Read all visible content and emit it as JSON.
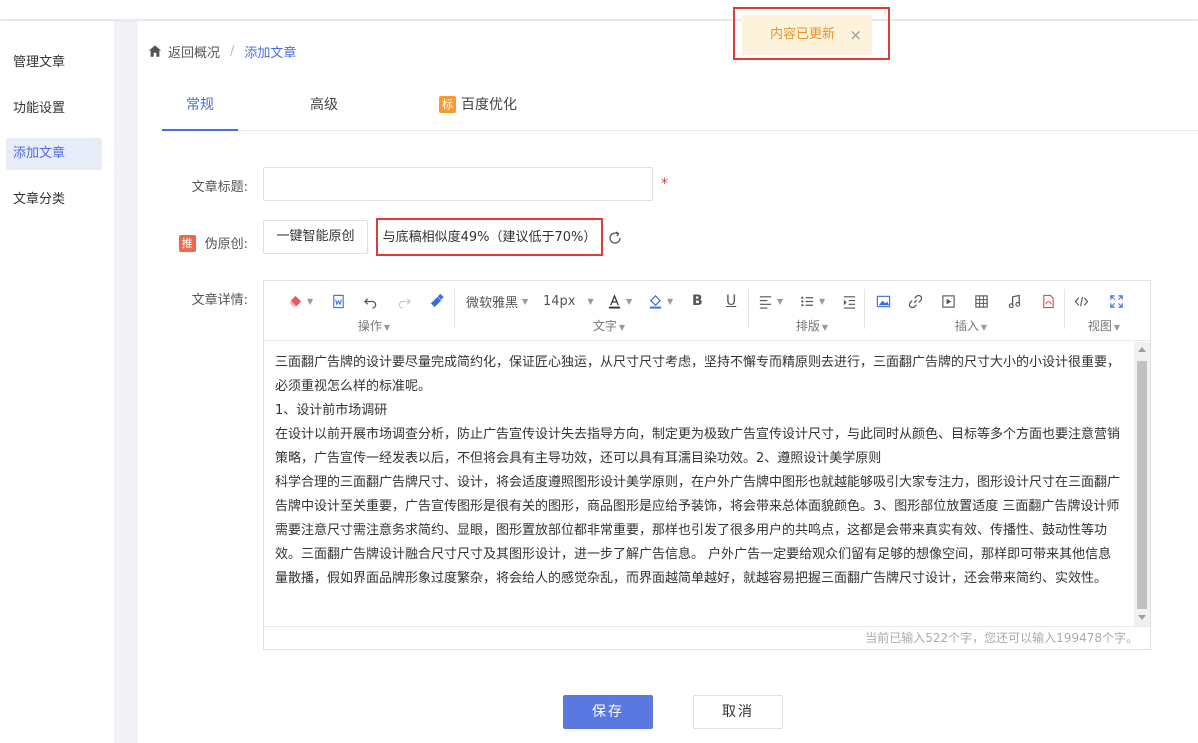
{
  "sidebar": {
    "items": [
      {
        "label": "管理文章"
      },
      {
        "label": "功能设置"
      },
      {
        "label": "添加文章"
      },
      {
        "label": "文章分类"
      }
    ]
  },
  "breadcrumb": {
    "back": "返回概况",
    "separator": "/",
    "current": "添加文章"
  },
  "tabs": [
    {
      "label": "常规"
    },
    {
      "label": "高级"
    },
    {
      "label": "百度优化",
      "badge": "标"
    }
  ],
  "form": {
    "title_label": "文章标题:",
    "title_value": "",
    "required_mark": "*",
    "pseudo_badge": "推",
    "pseudo_label": "伪原创:",
    "smart_button": "一键智能原创",
    "similarity": "与底稿相似度49%（建议低于70%）",
    "detail_label": "文章详情:"
  },
  "toolbar": {
    "font_family": "微软雅黑",
    "font_size": "14px",
    "bold": "B",
    "underline": "U",
    "groups": {
      "operations": "操作",
      "text": "文字",
      "layout": "排版",
      "insert": "插入",
      "view": "视图"
    }
  },
  "editor": {
    "paragraphs": [
      "三面翻广告牌的设计要尽量完成简约化，保证匠心独运，从尺寸尺寸考虑，坚持不懈专而精原则去进行，三面翻广告牌的尺寸大小的小设计很重要，必须重视怎么样的标准呢。",
      "1、设计前市场调研",
      "在设计以前开展市场调查分析，防止广告宣传设计失去指导方向，制定更为极致广告宣传设计尺寸，与此同时从颜色、目标等多个方面也要注意营销策略，广告宣传一经发表以后，不但将会具有主导功效，还可以具有耳濡目染功效。2、遵照设计美学原则",
      "科学合理的三面翻广告牌尺寸、设计，将会适度遵照图形设计美学原则，在户外广告牌中图形也就越能够吸引大家专注力，图形设计尺寸在三面翻广告牌中设计至关重要，广告宣传图形是很有关的图形，商品图形是应给予装饰，将会带来总体面貌颜色。3、图形部位放置适度 三面翻广告牌设计师需要注意尺寸需注意务求简约、显眼，图形置放部位都非常重要，那样也引发了很多用户的共鸣点，这都是会带来真实有效、传播性、鼓动性等功效。三面翻广告牌设计融合尺寸尺寸及其图形设计，进一步了解广告信息。 户外广告一定要给观众们留有足够的想像空间，那样即可带来其他信息量散播，假如界面品牌形象过度繁杂，将会给人的感觉杂乱，而界面越简单越好，就越容易把握三面翻广告牌尺寸设计，还会带来简约、实效性。"
    ],
    "counter": "当前已输入522个字，您还可以输入199478个字。"
  },
  "actions": {
    "save": "保存",
    "cancel": "取消"
  },
  "toast": {
    "message": "内容已更新",
    "close": "×"
  },
  "colors": {
    "accent": "#4a6ee0",
    "save_button": "#5b77e0",
    "highlight_border": "#e03b3b",
    "toast_bg": "#fdf2dc",
    "toast_text": "#e6952a"
  }
}
